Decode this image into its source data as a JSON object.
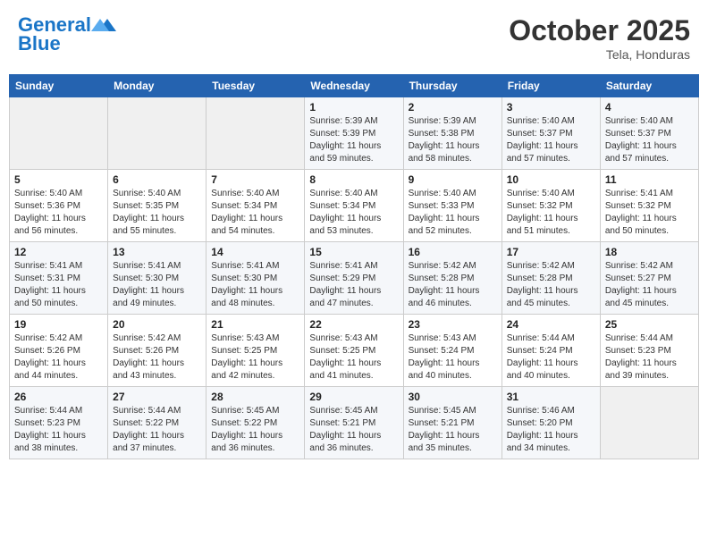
{
  "header": {
    "logo_line1": "General",
    "logo_line2": "Blue",
    "month_title": "October 2025",
    "location": "Tela, Honduras"
  },
  "days_of_week": [
    "Sunday",
    "Monday",
    "Tuesday",
    "Wednesday",
    "Thursday",
    "Friday",
    "Saturday"
  ],
  "weeks": [
    [
      {
        "day": "",
        "info": ""
      },
      {
        "day": "",
        "info": ""
      },
      {
        "day": "",
        "info": ""
      },
      {
        "day": "1",
        "info": "Sunrise: 5:39 AM\nSunset: 5:39 PM\nDaylight: 11 hours\nand 59 minutes."
      },
      {
        "day": "2",
        "info": "Sunrise: 5:39 AM\nSunset: 5:38 PM\nDaylight: 11 hours\nand 58 minutes."
      },
      {
        "day": "3",
        "info": "Sunrise: 5:40 AM\nSunset: 5:37 PM\nDaylight: 11 hours\nand 57 minutes."
      },
      {
        "day": "4",
        "info": "Sunrise: 5:40 AM\nSunset: 5:37 PM\nDaylight: 11 hours\nand 57 minutes."
      }
    ],
    [
      {
        "day": "5",
        "info": "Sunrise: 5:40 AM\nSunset: 5:36 PM\nDaylight: 11 hours\nand 56 minutes."
      },
      {
        "day": "6",
        "info": "Sunrise: 5:40 AM\nSunset: 5:35 PM\nDaylight: 11 hours\nand 55 minutes."
      },
      {
        "day": "7",
        "info": "Sunrise: 5:40 AM\nSunset: 5:34 PM\nDaylight: 11 hours\nand 54 minutes."
      },
      {
        "day": "8",
        "info": "Sunrise: 5:40 AM\nSunset: 5:34 PM\nDaylight: 11 hours\nand 53 minutes."
      },
      {
        "day": "9",
        "info": "Sunrise: 5:40 AM\nSunset: 5:33 PM\nDaylight: 11 hours\nand 52 minutes."
      },
      {
        "day": "10",
        "info": "Sunrise: 5:40 AM\nSunset: 5:32 PM\nDaylight: 11 hours\nand 51 minutes."
      },
      {
        "day": "11",
        "info": "Sunrise: 5:41 AM\nSunset: 5:32 PM\nDaylight: 11 hours\nand 50 minutes."
      }
    ],
    [
      {
        "day": "12",
        "info": "Sunrise: 5:41 AM\nSunset: 5:31 PM\nDaylight: 11 hours\nand 50 minutes."
      },
      {
        "day": "13",
        "info": "Sunrise: 5:41 AM\nSunset: 5:30 PM\nDaylight: 11 hours\nand 49 minutes."
      },
      {
        "day": "14",
        "info": "Sunrise: 5:41 AM\nSunset: 5:30 PM\nDaylight: 11 hours\nand 48 minutes."
      },
      {
        "day": "15",
        "info": "Sunrise: 5:41 AM\nSunset: 5:29 PM\nDaylight: 11 hours\nand 47 minutes."
      },
      {
        "day": "16",
        "info": "Sunrise: 5:42 AM\nSunset: 5:28 PM\nDaylight: 11 hours\nand 46 minutes."
      },
      {
        "day": "17",
        "info": "Sunrise: 5:42 AM\nSunset: 5:28 PM\nDaylight: 11 hours\nand 45 minutes."
      },
      {
        "day": "18",
        "info": "Sunrise: 5:42 AM\nSunset: 5:27 PM\nDaylight: 11 hours\nand 45 minutes."
      }
    ],
    [
      {
        "day": "19",
        "info": "Sunrise: 5:42 AM\nSunset: 5:26 PM\nDaylight: 11 hours\nand 44 minutes."
      },
      {
        "day": "20",
        "info": "Sunrise: 5:42 AM\nSunset: 5:26 PM\nDaylight: 11 hours\nand 43 minutes."
      },
      {
        "day": "21",
        "info": "Sunrise: 5:43 AM\nSunset: 5:25 PM\nDaylight: 11 hours\nand 42 minutes."
      },
      {
        "day": "22",
        "info": "Sunrise: 5:43 AM\nSunset: 5:25 PM\nDaylight: 11 hours\nand 41 minutes."
      },
      {
        "day": "23",
        "info": "Sunrise: 5:43 AM\nSunset: 5:24 PM\nDaylight: 11 hours\nand 40 minutes."
      },
      {
        "day": "24",
        "info": "Sunrise: 5:44 AM\nSunset: 5:24 PM\nDaylight: 11 hours\nand 40 minutes."
      },
      {
        "day": "25",
        "info": "Sunrise: 5:44 AM\nSunset: 5:23 PM\nDaylight: 11 hours\nand 39 minutes."
      }
    ],
    [
      {
        "day": "26",
        "info": "Sunrise: 5:44 AM\nSunset: 5:23 PM\nDaylight: 11 hours\nand 38 minutes."
      },
      {
        "day": "27",
        "info": "Sunrise: 5:44 AM\nSunset: 5:22 PM\nDaylight: 11 hours\nand 37 minutes."
      },
      {
        "day": "28",
        "info": "Sunrise: 5:45 AM\nSunset: 5:22 PM\nDaylight: 11 hours\nand 36 minutes."
      },
      {
        "day": "29",
        "info": "Sunrise: 5:45 AM\nSunset: 5:21 PM\nDaylight: 11 hours\nand 36 minutes."
      },
      {
        "day": "30",
        "info": "Sunrise: 5:45 AM\nSunset: 5:21 PM\nDaylight: 11 hours\nand 35 minutes."
      },
      {
        "day": "31",
        "info": "Sunrise: 5:46 AM\nSunset: 5:20 PM\nDaylight: 11 hours\nand 34 minutes."
      },
      {
        "day": "",
        "info": ""
      }
    ]
  ]
}
